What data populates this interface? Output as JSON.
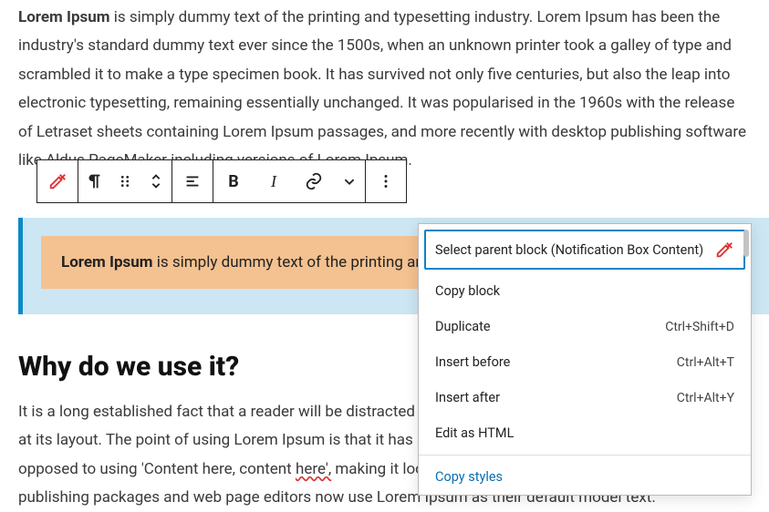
{
  "paragraph1": {
    "bold_lead": "Lorem Ipsum",
    "text": " is simply dummy text of the printing and typesetting industry. Lorem Ipsum has been the industry's standard dummy text ever since the 1500s, when an unknown printer took a galley of type and scrambled it to make a type specimen book. It has survived not only five centuries, but also the leap into electronic typesetting, remaining essentially unchanged. It was popularised in the 1960s with the release of Letraset sheets containing Lorem Ipsum passages, and more recently with desktop publishing software like Aldus PageMaker including versions of Lorem Ipsum."
  },
  "notification": {
    "bold_lead": "Lorem Ipsum",
    "text": " is simply dummy text of the printing and typesetting industry."
  },
  "heading": "Why do we use it?",
  "paragraph2_a": "It is a long established fact that a reader will be distracted by the readable content of a page when looking at its layout. The point of using Lorem Ipsum is that it has a more-or-less normal distribution of letters, as opposed to using 'Content here, content ",
  "paragraph2_err": "here',",
  "paragraph2_b": " making it look like readable English. Many desktop publishing packages and web page editors now use Lorem Ipsum as their default model text.",
  "toolbar": {
    "block_type": "Notification Box Content",
    "bold": "B",
    "italic": "I"
  },
  "menu": {
    "parent_label": "Select parent block (Notification Box Content)",
    "copy_block": "Copy block",
    "duplicate": {
      "label": "Duplicate",
      "shortcut": "Ctrl+Shift+D"
    },
    "insert_before": {
      "label": "Insert before",
      "shortcut": "Ctrl+Alt+T"
    },
    "insert_after": {
      "label": "Insert after",
      "shortcut": "Ctrl+Alt+Y"
    },
    "edit_html": "Edit as HTML",
    "copy_styles": "Copy styles"
  }
}
